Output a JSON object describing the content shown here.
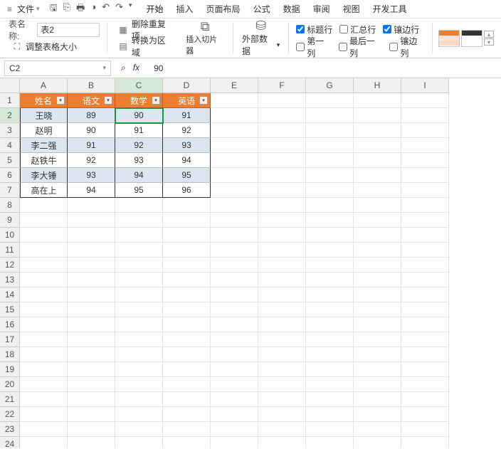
{
  "menu": {
    "file": "文件"
  },
  "tabs": [
    "开始",
    "插入",
    "页面布局",
    "公式",
    "数据",
    "审阅",
    "视图",
    "开发工具"
  ],
  "ribbon": {
    "tableNameLabel": "表名称:",
    "tableName": "表2",
    "resize": "调整表格大小",
    "removeDup": "删除重复项",
    "toRange": "转换为区域",
    "slicer": "插入切片器",
    "extData": "外部数据",
    "opt": {
      "headerRow": "标题行",
      "totalRow": "汇总行",
      "banded": "镶边行",
      "firstCol": "第一列",
      "lastCol": "最后一列",
      "bandedCol": "镶边列"
    }
  },
  "formulaBar": {
    "ref": "C2",
    "value": "90"
  },
  "cols": [
    "A",
    "B",
    "C",
    "D",
    "E",
    "F",
    "G",
    "H",
    "I"
  ],
  "rowCount": 24,
  "activeCol": 2,
  "activeRow": 1,
  "table": {
    "headers": [
      "姓名",
      "语文",
      "数学",
      "英语"
    ],
    "rows": [
      [
        "王晓",
        "89",
        "90",
        "91"
      ],
      [
        "赵明",
        "90",
        "91",
        "92"
      ],
      [
        "李二强",
        "91",
        "92",
        "93"
      ],
      [
        "赵铁牛",
        "92",
        "93",
        "94"
      ],
      [
        "李大锤",
        "93",
        "94",
        "95"
      ],
      [
        "高在上",
        "94",
        "95",
        "96"
      ]
    ]
  }
}
